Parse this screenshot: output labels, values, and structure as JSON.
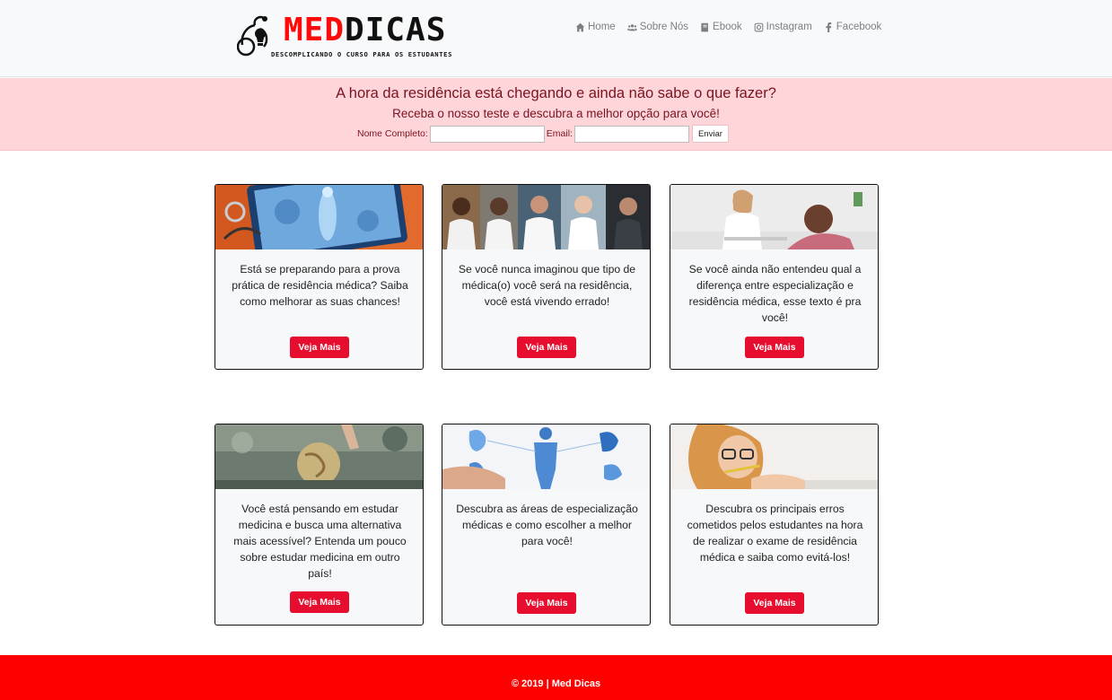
{
  "brand": {
    "name_red": "MED",
    "name_dark": "DICAS",
    "tagline": "DESCOMPLICANDO O CURSO PARA OS ESTUDANTES"
  },
  "nav": [
    {
      "icon": "home-icon",
      "label": "Home"
    },
    {
      "icon": "users-icon",
      "label": "Sobre Nós"
    },
    {
      "icon": "book-icon",
      "label": "Ebook"
    },
    {
      "icon": "instagram-icon",
      "label": "Instagram"
    },
    {
      "icon": "facebook-icon",
      "label": "Facebook"
    }
  ],
  "banner": {
    "title": "A hora da residência está chegando e ainda não sabe o que fazer?",
    "subtitle": "Receba o nosso teste e descubra a melhor opção para você!",
    "name_label": "Nome Completo:",
    "name_value": "",
    "email_label": "Email:",
    "email_value": "",
    "submit_label": "Enviar"
  },
  "cards": [
    {
      "text": "Está se preparando para a prova prática de residência médica? Saiba como melhorar as suas chances!",
      "button": "Veja Mais"
    },
    {
      "text": "Se você nunca imaginou que tipo de médica(o) você será na residência, você está vivendo errado!",
      "button": "Veja Mais"
    },
    {
      "text": "Se você ainda não entendeu qual a diferença entre especialização e residência médica, esse texto é pra você!",
      "button": "Veja Mais"
    },
    {
      "text": "Você está pensando em estudar medicina e busca uma alternativa mais acessível? Entenda um pouco sobre estudar medicina em outro país!",
      "button": "Veja Mais"
    },
    {
      "text": "Descubra as áreas de especialização médicas e como escolher a melhor para você!",
      "button": "Veja Mais"
    },
    {
      "text": "Descubra os principais erros cometidos pelos estudantes na hora de realizar o exame de residência médica e saiba como evitá-los!",
      "button": "Veja Mais"
    }
  ],
  "footer": {
    "text": "© 2019 | Med Dicas"
  },
  "colors": {
    "accent": "#e60d2e",
    "footer_bg": "#ff0000",
    "banner_bg": "#fed6da",
    "banner_text": "#7c1220"
  }
}
